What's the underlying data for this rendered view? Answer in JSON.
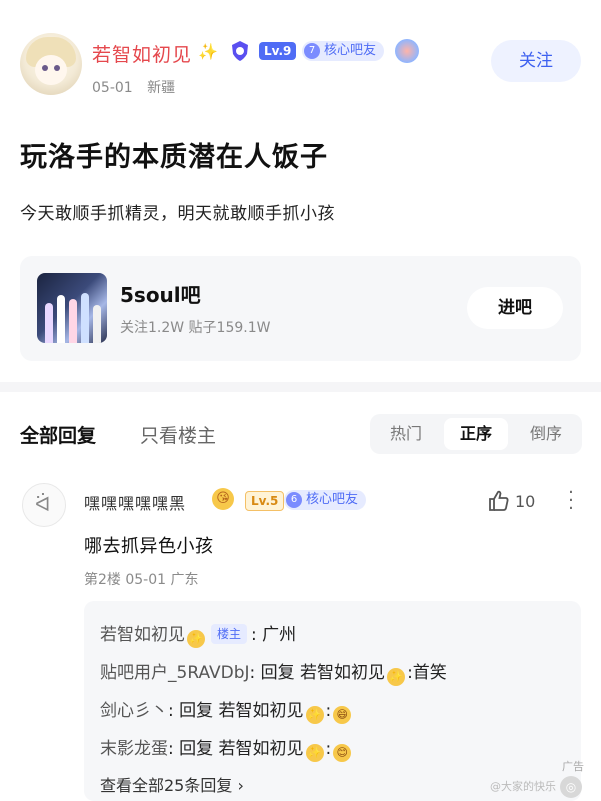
{
  "post": {
    "author": {
      "name": "若智如初见",
      "level": "Lv.9",
      "core_number": "7",
      "core_badge": "核心吧友"
    },
    "date": "05-01",
    "location": "新疆",
    "follow_label": "关注",
    "title": "玩洛手的本质潜在人饭子",
    "body": "今天敢顺手抓精灵，明天就敢顺手抓小孩"
  },
  "forum": {
    "name": "5soul吧",
    "stats": "关注1.2W  贴子159.1W",
    "enter_label": "进吧"
  },
  "tabs": {
    "all_replies": "全部回复",
    "op_only": "只看楼主",
    "sort": [
      "热门",
      "正序",
      "倒序"
    ]
  },
  "reply": {
    "author": "嘿嘿嘿嘿嘿黑",
    "level": "Lv.5",
    "core_number": "6",
    "core_badge": "核心吧友",
    "likes": "10",
    "content": "哪去抓异色小孩",
    "meta": "第2楼  05-01  广东",
    "sub_replies": [
      {
        "name": "若智如初见",
        "tag": "楼主",
        "text": ": 广州"
      },
      {
        "name": "贴吧用户_5RAVDbJ",
        "text": ": 回复 若智如初见",
        "suffix": ":首笑"
      },
      {
        "name": "剑心彡丶",
        "text": ": 回复 若智如初见"
      },
      {
        "name": "末影龙蛋",
        "text": ": 回复 若智如初见"
      }
    ],
    "view_all": "查看全部25条回复 ›"
  },
  "ad_label": "广告",
  "watermark": "@大家的快乐",
  "colors": {
    "accent": "#4f6cf5",
    "username_red": "#e5484d",
    "follow_text": "#3e61f0"
  }
}
